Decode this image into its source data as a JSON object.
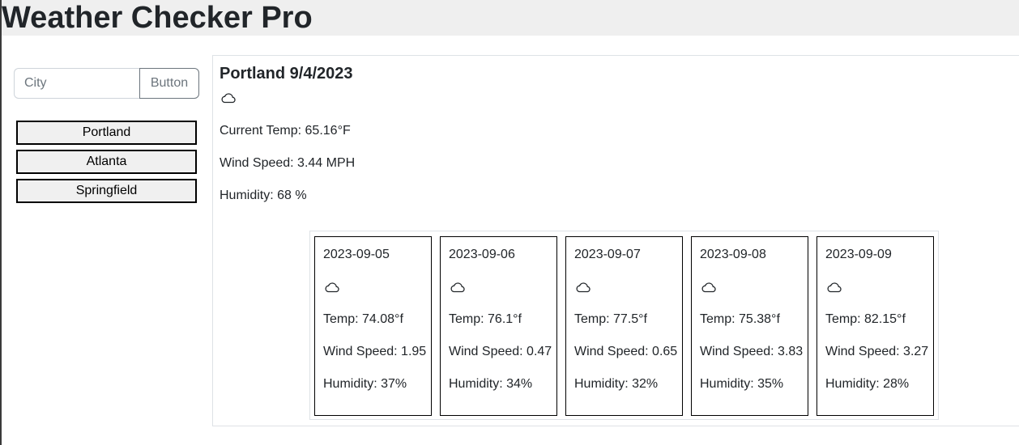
{
  "app": {
    "title": "Weather Checker Pro"
  },
  "search": {
    "placeholder": "City",
    "button_label": "Button"
  },
  "history": [
    "Portland",
    "Atlanta",
    "Springfield"
  ],
  "current": {
    "title": "Portland 9/4/2023",
    "icon": "cloud-icon",
    "temp": "Current Temp: 65.16°F",
    "wind": "Wind Speed: 3.44 MPH",
    "humidity": "Humidity: 68 %"
  },
  "forecast": [
    {
      "date": "2023-09-05",
      "icon": "cloud-icon",
      "temp": "Temp: 74.08°f",
      "wind": "Wind Speed: 1.95",
      "humidity": "Humidity: 37%"
    },
    {
      "date": "2023-09-06",
      "icon": "cloud-icon",
      "temp": "Temp: 76.1°f",
      "wind": "Wind Speed: 0.47",
      "humidity": "Humidity: 34%"
    },
    {
      "date": "2023-09-07",
      "icon": "cloud-icon",
      "temp": "Temp: 77.5°f",
      "wind": "Wind Speed: 0.65",
      "humidity": "Humidity: 32%"
    },
    {
      "date": "2023-09-08",
      "icon": "cloud-icon",
      "temp": "Temp: 75.38°f",
      "wind": "Wind Speed: 3.83",
      "humidity": "Humidity: 35%"
    },
    {
      "date": "2023-09-09",
      "icon": "cloud-icon",
      "temp": "Temp: 82.15°f",
      "wind": "Wind Speed: 3.27",
      "humidity": "Humidity: 28%"
    }
  ]
}
